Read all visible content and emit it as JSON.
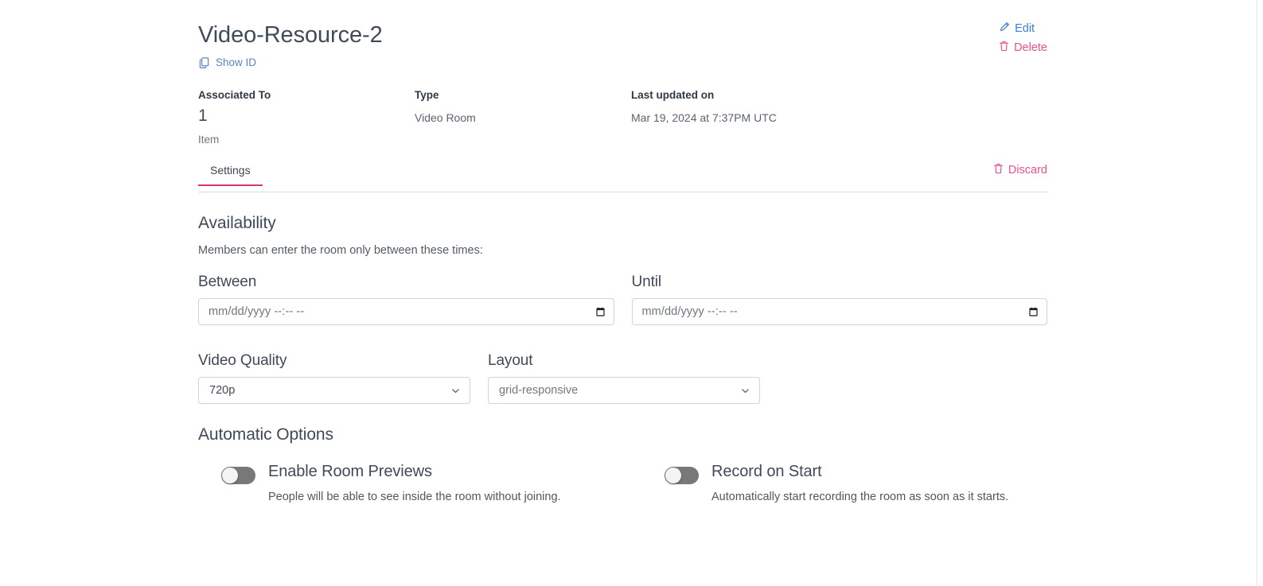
{
  "header": {
    "title": "Video-Resource-2",
    "show_id_label": "Show ID",
    "show_id_icon": "copy-icon",
    "edit_label": "Edit",
    "edit_icon": "pencil-icon",
    "edit_color": "#3d7fd6",
    "delete_label": "Delete",
    "delete_icon": "trash-icon",
    "delete_color": "#e8518f"
  },
  "meta": {
    "associated_to": {
      "label": "Associated To",
      "value": "1",
      "sublabel": "Item"
    },
    "type": {
      "label": "Type",
      "value": "Video Room"
    },
    "last_updated": {
      "label": "Last updated on",
      "value": "Mar 19, 2024 at 7:37PM UTC"
    }
  },
  "tabs": {
    "items": [
      {
        "label": "Settings",
        "active": true
      }
    ],
    "active_indicator_color": "#d9346f",
    "discard_label": "Discard",
    "discard_icon": "trash-icon",
    "discard_color": "#e8518f"
  },
  "availability": {
    "title": "Availability",
    "description": "Members can enter the room only between these times:",
    "between": {
      "label": "Between",
      "value": "",
      "placeholder": "mm/dd/yyyy --:-- --",
      "calendar_icon": "calendar-icon"
    },
    "until": {
      "label": "Until",
      "value": "",
      "placeholder": "mm/dd/yyyy --:-- --",
      "calendar_icon": "calendar-icon"
    }
  },
  "selects": {
    "video_quality": {
      "label": "Video Quality",
      "selected": "720p",
      "chevron_icon": "chevron-down-icon"
    },
    "layout": {
      "label": "Layout",
      "selected": "grid-responsive",
      "chevron_icon": "chevron-down-icon"
    }
  },
  "automatic_options": {
    "title": "Automatic Options",
    "toggles": [
      {
        "title": "Enable Room Previews",
        "description": "People will be able to see inside the room without joining.",
        "state": "off"
      },
      {
        "title": "Record on Start",
        "description": "Automatically start recording the room as soon as it starts.",
        "state": "off"
      }
    ]
  }
}
